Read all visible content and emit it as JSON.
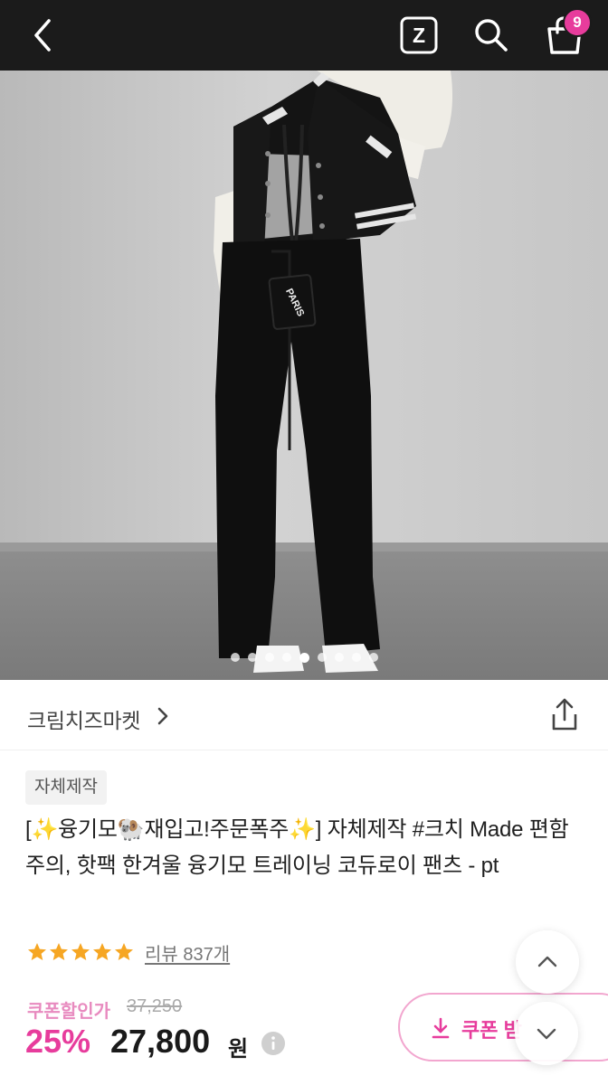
{
  "header": {
    "icons": [
      "back-icon",
      "z-icon",
      "search-icon",
      "shopping-bag-icon"
    ],
    "cart_count": "9",
    "z_label": "Z"
  },
  "gallery": {
    "image_count": 9,
    "active_index": 5,
    "bag_tag_text": "PARIS"
  },
  "store": {
    "name": "크림치즈마켓",
    "share_icon": "share-icon"
  },
  "product": {
    "badge": "자체제작",
    "title": "[✨융기모🐏재입고!주문폭주✨] 자체제작 #크치 Made 편함주의, 핫팩 한겨울 융기모 트레이닝 코듀로이 팬츠 - pt",
    "rating_stars": 5,
    "review_text": "리뷰 837개"
  },
  "price": {
    "coupon_label": "쿠폰할인가",
    "original": "37,250",
    "discount": "25%",
    "final": "27,800",
    "currency": "원"
  },
  "actions": {
    "coupon_button": "쿠폰 받",
    "scroll_up_icon": "chevron-up-icon",
    "scroll_down_icon": "chevron-down-icon"
  },
  "colors": {
    "accent": "#e73c9c",
    "header_bg": "#1b1b1b",
    "star": "#f6a623"
  }
}
